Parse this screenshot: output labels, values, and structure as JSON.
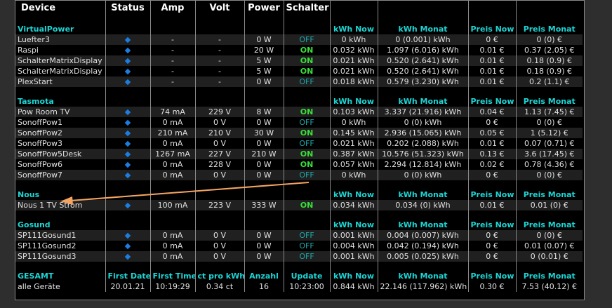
{
  "header": [
    "Device",
    "Status",
    "Amp",
    "Volt",
    "Power",
    "Schalter",
    "",
    "",
    "",
    ""
  ],
  "colors": {
    "group": "#1ed4d4",
    "on": "#3ae03a",
    "off": "#1fa7a7",
    "status_dot": "#1a7de0",
    "arrow": "#f4a460"
  },
  "status_icon": "diamond-icon",
  "groups": [
    {
      "name": "VirtualPower",
      "cols": [
        "kWh Now",
        "kWh Monat",
        "Preis Now",
        "Preis Monat"
      ],
      "devices": [
        {
          "name": "Luefter3",
          "amp": "-",
          "volt": "-",
          "power": "0 W",
          "sw": "OFF",
          "kwh_now": "0 kWh",
          "kwh_month": "0 (0.001) kWh",
          "price_now": "0 €",
          "price_month": "0 (0) €"
        },
        {
          "name": "Raspi",
          "amp": "-",
          "volt": "-",
          "power": "20 W",
          "sw": "ON",
          "kwh_now": "0.032 kWh",
          "kwh_month": "1.097 (6.016) kWh",
          "price_now": "0.01 €",
          "price_month": "0.37 (2.05) €"
        },
        {
          "name": "SchalterMatrixDisplay",
          "amp": "-",
          "volt": "-",
          "power": "5 W",
          "sw": "ON",
          "kwh_now": "0.021 kWh",
          "kwh_month": "0.520 (2.641) kWh",
          "price_now": "0.01 €",
          "price_month": "0.18 (0.9) €"
        },
        {
          "name": "SchalterMatrixDisplay",
          "amp": "-",
          "volt": "-",
          "power": "5 W",
          "sw": "ON",
          "kwh_now": "0.021 kWh",
          "kwh_month": "0.520 (2.641) kWh",
          "price_now": "0.01 €",
          "price_month": "0.18 (0.9) €"
        },
        {
          "name": "PlexStart",
          "amp": "-",
          "volt": "-",
          "power": "0 W",
          "sw": "OFF",
          "kwh_now": "0.018 kWh",
          "kwh_month": "0.579 (3.230) kWh",
          "price_now": "0.01 €",
          "price_month": "0.2 (1.1) €"
        }
      ]
    },
    {
      "name": "Tasmota",
      "cols": [
        "kWh Now",
        "kWh Monat",
        "Preis Now",
        "Preis Monat"
      ],
      "devices": [
        {
          "name": "Pow Room TV",
          "amp": "74 mA",
          "volt": "229 V",
          "power": "8 W",
          "sw": "ON",
          "kwh_now": "0.103 kWh",
          "kwh_month": "3.337 (21.916) kWh",
          "price_now": "0.04 €",
          "price_month": "1.13 (7.45) €"
        },
        {
          "name": "SonoffPow1",
          "amp": "0 mA",
          "volt": "0 V",
          "power": "0 W",
          "sw": "OFF",
          "kwh_now": "0 kWh",
          "kwh_month": "0 (0) kWh",
          "price_now": "0 €",
          "price_month": "0 (0) €"
        },
        {
          "name": "SonoffPow2",
          "amp": "210 mA",
          "volt": "210 V",
          "power": "30 W",
          "sw": "ON",
          "kwh_now": "0.145 kWh",
          "kwh_month": "2.936 (15.065) kWh",
          "price_now": "0.05 €",
          "price_month": "1 (5.12) €"
        },
        {
          "name": "SonoffPow3",
          "amp": "0 mA",
          "volt": "0 V",
          "power": "0 W",
          "sw": "OFF",
          "kwh_now": "0.021 kWh",
          "kwh_month": "0.202 (2.088) kWh",
          "price_now": "0.01 €",
          "price_month": "0.07 (0.71) €"
        },
        {
          "name": "SonoffPow5Desk",
          "amp": "1267 mA",
          "volt": "227 V",
          "power": "210 W",
          "sw": "ON",
          "kwh_now": "0.387 kWh",
          "kwh_month": "10.576 (51.323) kWh",
          "price_now": "0.13 €",
          "price_month": "3.6 (17.45) €"
        },
        {
          "name": "SonoffPow6",
          "amp": "0 mA",
          "volt": "228 V",
          "power": "0 W",
          "sw": "ON",
          "kwh_now": "0.057 kWh",
          "kwh_month": "2.294 (12.814) kWh",
          "price_now": "0.02 €",
          "price_month": "0.78 (4.36) €"
        },
        {
          "name": "SonoffPow7",
          "amp": "0 mA",
          "volt": "0 V",
          "power": "0 W",
          "sw": "OFF",
          "kwh_now": "0 kWh",
          "kwh_month": "0 (0) kWh",
          "price_now": "0 €",
          "price_month": "0 (0) €"
        }
      ]
    },
    {
      "name": "Nous",
      "cols": [
        "kWh Now",
        "kWh Monat",
        "Preis Now",
        "Preis Monat"
      ],
      "devices": [
        {
          "name": "Nous 1 TV Strom",
          "amp": "100 mA",
          "volt": "223 V",
          "power": "333 W",
          "sw": "ON",
          "kwh_now": "0.034 kWh",
          "kwh_month": "0.034 (0) kWh",
          "price_now": "0.01 €",
          "price_month": "0.01 (0) €"
        }
      ]
    },
    {
      "name": "Gosund",
      "cols": [
        "kWh Now",
        "kWh Monat",
        "Preis Now",
        "Preis Monat"
      ],
      "devices": [
        {
          "name": "SP111Gosund1",
          "amp": "0 mA",
          "volt": "0 V",
          "power": "0 W",
          "sw": "OFF",
          "kwh_now": "0.001 kWh",
          "kwh_month": "0.004 (0.007) kWh",
          "price_now": "0 €",
          "price_month": "0 (0) €"
        },
        {
          "name": "SP111Gosund2",
          "amp": "0 mA",
          "volt": "0 V",
          "power": "0 W",
          "sw": "OFF",
          "kwh_now": "0.004 kWh",
          "kwh_month": "0.042 (0.194) kWh",
          "price_now": "0 €",
          "price_month": "0.01 (0.07) €"
        },
        {
          "name": "SP111Gosund3",
          "amp": "0 mA",
          "volt": "0 V",
          "power": "0 W",
          "sw": "OFF",
          "kwh_now": "0.001 kWh",
          "kwh_month": "0.005 (0.025) kWh",
          "price_now": "0 €",
          "price_month": "0 (0.01) €"
        }
      ]
    }
  ],
  "summary": {
    "labels": [
      "GESAMT",
      "First Date",
      "First Time",
      "ct pro kWh",
      "Anzahl",
      "Update",
      "kWh Now",
      "kWh Monat",
      "Preis Now",
      "Preis Monat"
    ],
    "values": [
      "alle Geräte",
      "20.01.21",
      "10:19:29",
      "0.34 ct",
      "16",
      "10:23:00",
      "0.844 kWh",
      "22.146 (117.962) kWh",
      "0.30 €",
      "7.53 (40.12) €"
    ]
  }
}
